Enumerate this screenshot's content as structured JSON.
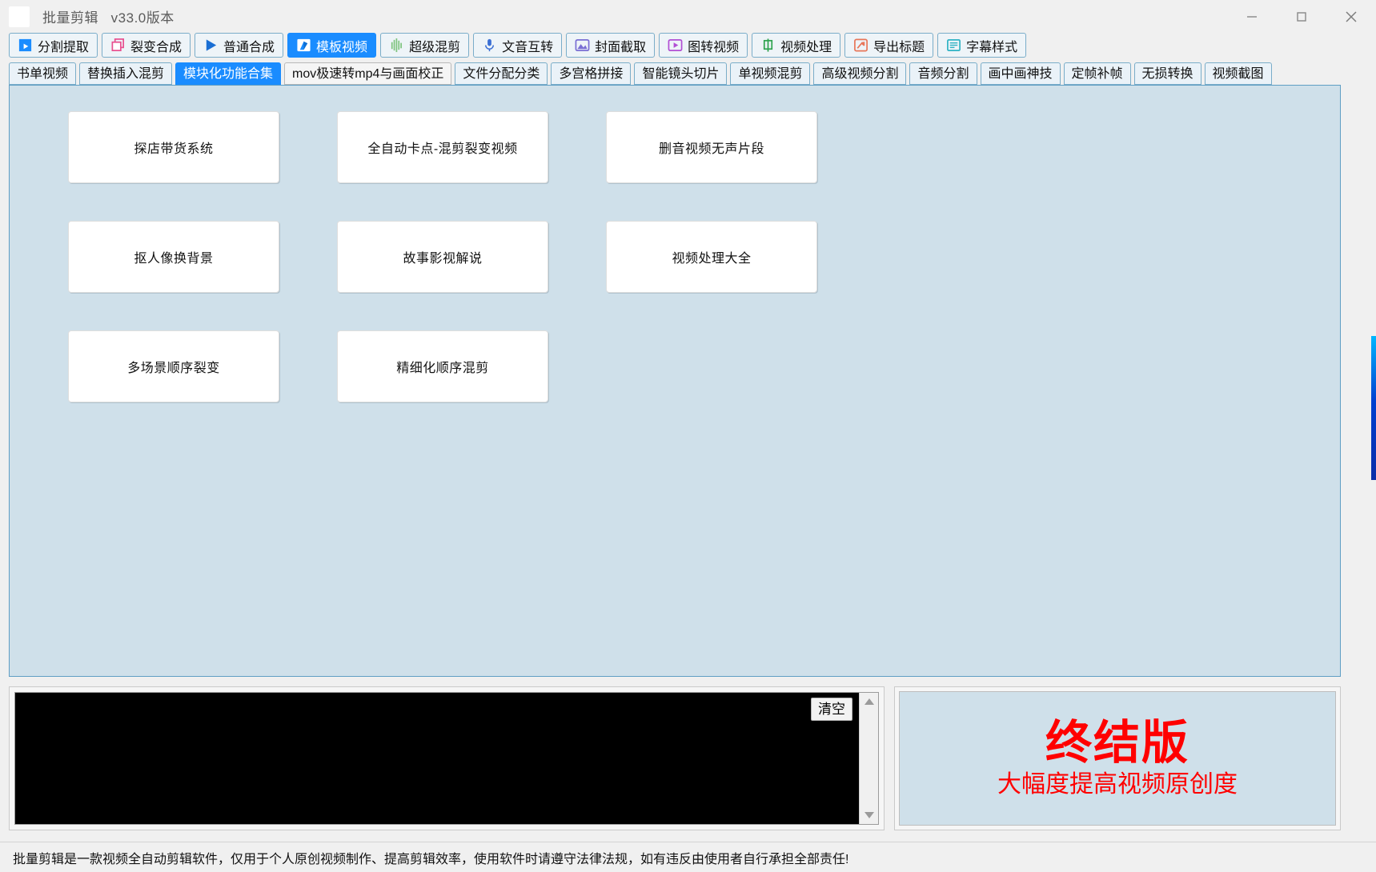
{
  "window": {
    "title": "批量剪辑",
    "version": "v33.0版本",
    "app_icon": "app-icon",
    "controls": {
      "minimize": "minimize-icon",
      "maximize": "maximize-icon",
      "close": "close-icon"
    }
  },
  "toolbar": {
    "items": [
      {
        "label": "分割提取",
        "icon": "film-clapper-icon",
        "icon_color": "#1a8cff",
        "active": false
      },
      {
        "label": "裂变合成",
        "icon": "copy-layers-icon",
        "icon_color": "#e8508f",
        "active": false
      },
      {
        "label": "普通合成",
        "icon": "play-triangle-icon",
        "icon_color": "#1a6fd4",
        "active": false
      },
      {
        "label": "模板视频",
        "icon": "template-flag-icon",
        "icon_color": "#ffffff",
        "active": true
      },
      {
        "label": "超级混剪",
        "icon": "waveform-icon",
        "icon_color": "#7ec47e",
        "active": false
      },
      {
        "label": "文音互转",
        "icon": "microphone-icon",
        "icon_color": "#3b6fd4",
        "active": false
      },
      {
        "label": "封面截取",
        "icon": "image-mountain-icon",
        "icon_color": "#7a6fd4",
        "active": false
      },
      {
        "label": "图转视频",
        "icon": "image-play-icon",
        "icon_color": "#b24fd4",
        "active": false
      },
      {
        "label": "视频处理",
        "icon": "cn-char-zhong-icon",
        "icon_color": "#2fa34f",
        "active": false
      },
      {
        "label": "导出标题",
        "icon": "export-arrow-icon",
        "icon_color": "#e8775a",
        "active": false
      },
      {
        "label": "字幕样式",
        "icon": "subtitle-lines-icon",
        "icon_color": "#2fb3c4",
        "active": false
      }
    ]
  },
  "tabs": {
    "items": [
      {
        "label": "书单视频",
        "active": false,
        "style": "blue"
      },
      {
        "label": "替换插入混剪",
        "active": false,
        "style": "blue"
      },
      {
        "label": "模块化功能合集",
        "active": true,
        "style": "blue"
      },
      {
        "label": "mov极速转mp4与画面校正",
        "active": false,
        "style": "plain"
      },
      {
        "label": "文件分配分类",
        "active": false,
        "style": "blue"
      },
      {
        "label": "多宫格拼接",
        "active": false,
        "style": "blue"
      },
      {
        "label": "智能镜头切片",
        "active": false,
        "style": "blue"
      },
      {
        "label": "单视频混剪",
        "active": false,
        "style": "blue"
      },
      {
        "label": "高级视频分割",
        "active": false,
        "style": "blue"
      },
      {
        "label": "音频分割",
        "active": false,
        "style": "blue"
      },
      {
        "label": "画中画神技",
        "active": false,
        "style": "blue"
      },
      {
        "label": "定帧补帧",
        "active": false,
        "style": "blue"
      },
      {
        "label": "无损转换",
        "active": false,
        "style": "blue"
      },
      {
        "label": "视频截图",
        "active": false,
        "style": "blue"
      }
    ]
  },
  "main": {
    "function_buttons": [
      {
        "label": "探店带货系统",
        "col": 0,
        "row": 0
      },
      {
        "label": "全自动卡点-混剪裂变视频",
        "col": 1,
        "row": 0
      },
      {
        "label": "删音视频无声片段",
        "col": 2,
        "row": 0
      },
      {
        "label": "抠人像换背景",
        "col": 0,
        "row": 1
      },
      {
        "label": "故事影视解说",
        "col": 1,
        "row": 1
      },
      {
        "label": "视频处理大全",
        "col": 2,
        "row": 1
      },
      {
        "label": "多场景顺序裂变",
        "col": 0,
        "row": 2
      },
      {
        "label": "精细化顺序混剪",
        "col": 1,
        "row": 2
      }
    ]
  },
  "log": {
    "content": "",
    "clear_label": "清空",
    "scroll_up_icon": "triangle-up-icon",
    "scroll_down_icon": "triangle-down-icon"
  },
  "promo": {
    "title": "终结版",
    "subtitle": "大幅度提高视频原创度",
    "color": "#ff0000"
  },
  "status": {
    "text": "批量剪辑是一款视频全自动剪辑软件，仅用于个人原创视频制作、提高剪辑效率，使用软件时请遵守法律法规，如有违反由使用者自行承担全部责任!"
  },
  "colors": {
    "accent": "#1a8cff",
    "panel_bg": "#cfe0ea",
    "panel_border": "#5f9ec4",
    "window_bg": "#f0f0f0"
  }
}
